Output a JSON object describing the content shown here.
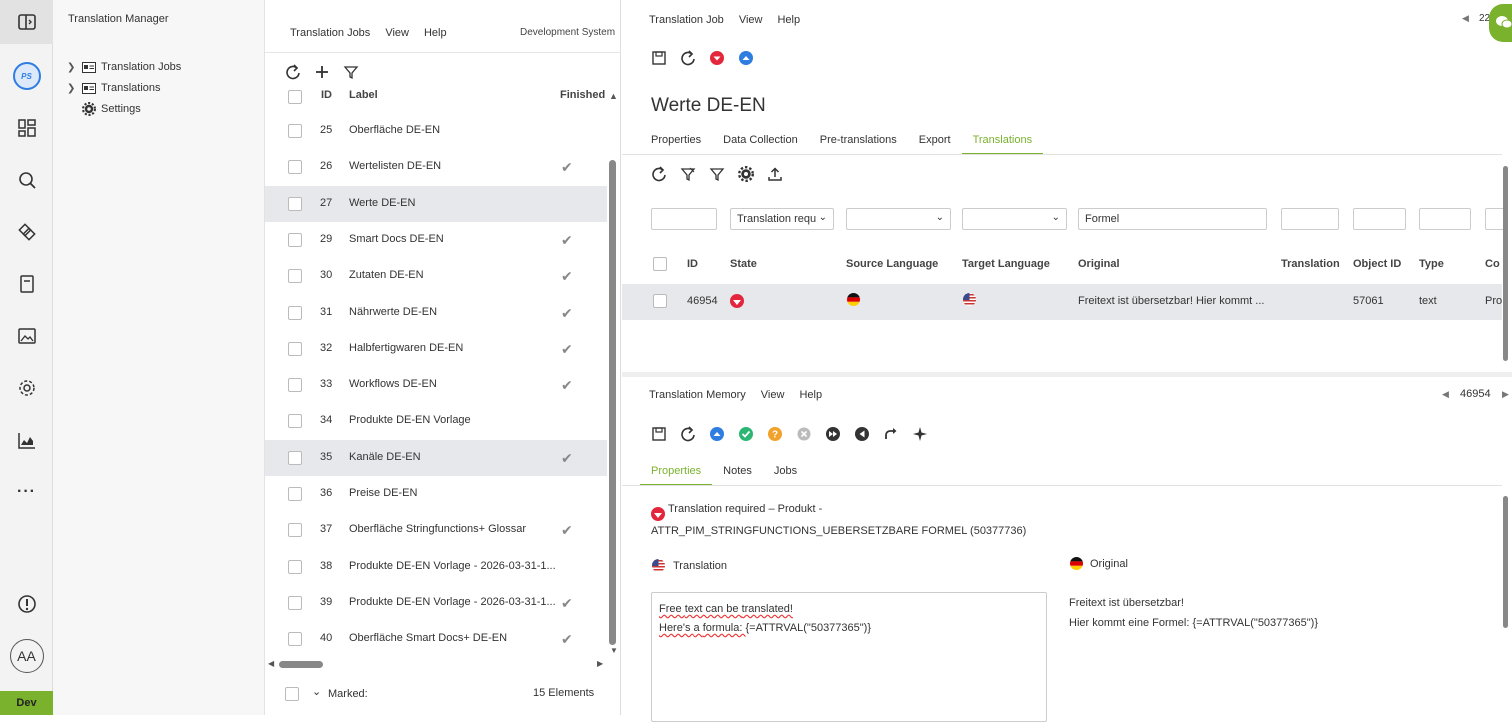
{
  "nav": {
    "title": "Translation Manager",
    "items": [
      {
        "label": "Translation Jobs"
      },
      {
        "label": "Translations"
      },
      {
        "label": "Settings"
      }
    ],
    "avatar": "AA",
    "env_badge": "Dev",
    "logo": "PS"
  },
  "jobs": {
    "menu": [
      "Translation Jobs",
      "View",
      "Help"
    ],
    "system": "Development System",
    "columns": {
      "id": "ID",
      "label": "Label",
      "finished": "Finished"
    },
    "rows": [
      {
        "id": "25",
        "label": "Oberfläche DE-EN",
        "finished": false
      },
      {
        "id": "26",
        "label": "Wertelisten DE-EN",
        "finished": true
      },
      {
        "id": "27",
        "label": "Werte DE-EN",
        "finished": false
      },
      {
        "id": "29",
        "label": "Smart Docs DE-EN",
        "finished": true
      },
      {
        "id": "30",
        "label": "Zutaten DE-EN",
        "finished": true
      },
      {
        "id": "31",
        "label": "Nährwerte DE-EN",
        "finished": true
      },
      {
        "id": "32",
        "label": "Halbfertigwaren DE-EN",
        "finished": true
      },
      {
        "id": "33",
        "label": "Workflows DE-EN",
        "finished": true
      },
      {
        "id": "34",
        "label": "Produkte DE-EN Vorlage",
        "finished": false
      },
      {
        "id": "35",
        "label": "Kanäle DE-EN",
        "finished": true
      },
      {
        "id": "36",
        "label": "Preise DE-EN",
        "finished": false
      },
      {
        "id": "37",
        "label": "Oberfläche Stringfunctions+ Glossar",
        "finished": true
      },
      {
        "id": "38",
        "label": "Produkte DE-EN Vorlage - 2026-03-31-1...",
        "finished": false
      },
      {
        "id": "39",
        "label": "Produkte DE-EN Vorlage - 2026-03-31-1...",
        "finished": true
      },
      {
        "id": "40",
        "label": "Oberfläche Smart Docs+ DE-EN",
        "finished": true
      }
    ],
    "selected_id": "27",
    "hover_id": "35",
    "footer": {
      "marked": "Marked:",
      "count": "15 Elements"
    }
  },
  "job": {
    "menu": [
      "Translation Job",
      "View",
      "Help"
    ],
    "page_indicator": "22",
    "title": "Werte DE-EN",
    "tabs": [
      "Properties",
      "Data Collection",
      "Pre-translations",
      "Export",
      "Translations"
    ],
    "active_tab": "Translations",
    "filters": {
      "state": "Translation requ",
      "original": "Formel"
    },
    "grid_columns": [
      "ID",
      "State",
      "Source Language",
      "Target Language",
      "Original",
      "Translation",
      "Object ID",
      "Type",
      "Co"
    ],
    "grid_rows": [
      {
        "id": "46954",
        "state": "required",
        "source": "de",
        "target": "en-us",
        "original": "Freitext ist übersetzbar! Hier kommt ...",
        "translation": "",
        "object_id": "57061",
        "type": "text",
        "co": "Pro"
      }
    ]
  },
  "memory": {
    "menu": [
      "Translation Memory",
      "View",
      "Help"
    ],
    "record_id": "46954",
    "tabs": [
      "Properties",
      "Notes",
      "Jobs"
    ],
    "active_tab": "Properties",
    "status_line1": "Translation required – Produkt -",
    "status_line2": "ATTR_PIM_STRINGFUNCTIONS_UEBERSETZBARE FORMEL (50377736)",
    "translation_label": "Translation",
    "original_label": "Original",
    "translation_lines": [
      "Free text can be translated!",
      "Here's a formula: {=ATTRVAL(\"50377365\")}"
    ],
    "original_lines": [
      "Freitext ist übersetzbar!",
      "Hier kommt eine Formel: {=ATTRVAL(\"50377365\")}"
    ]
  },
  "colors": {
    "accent": "#7ab22d",
    "danger": "#e3263b",
    "info": "#2f7de1"
  }
}
